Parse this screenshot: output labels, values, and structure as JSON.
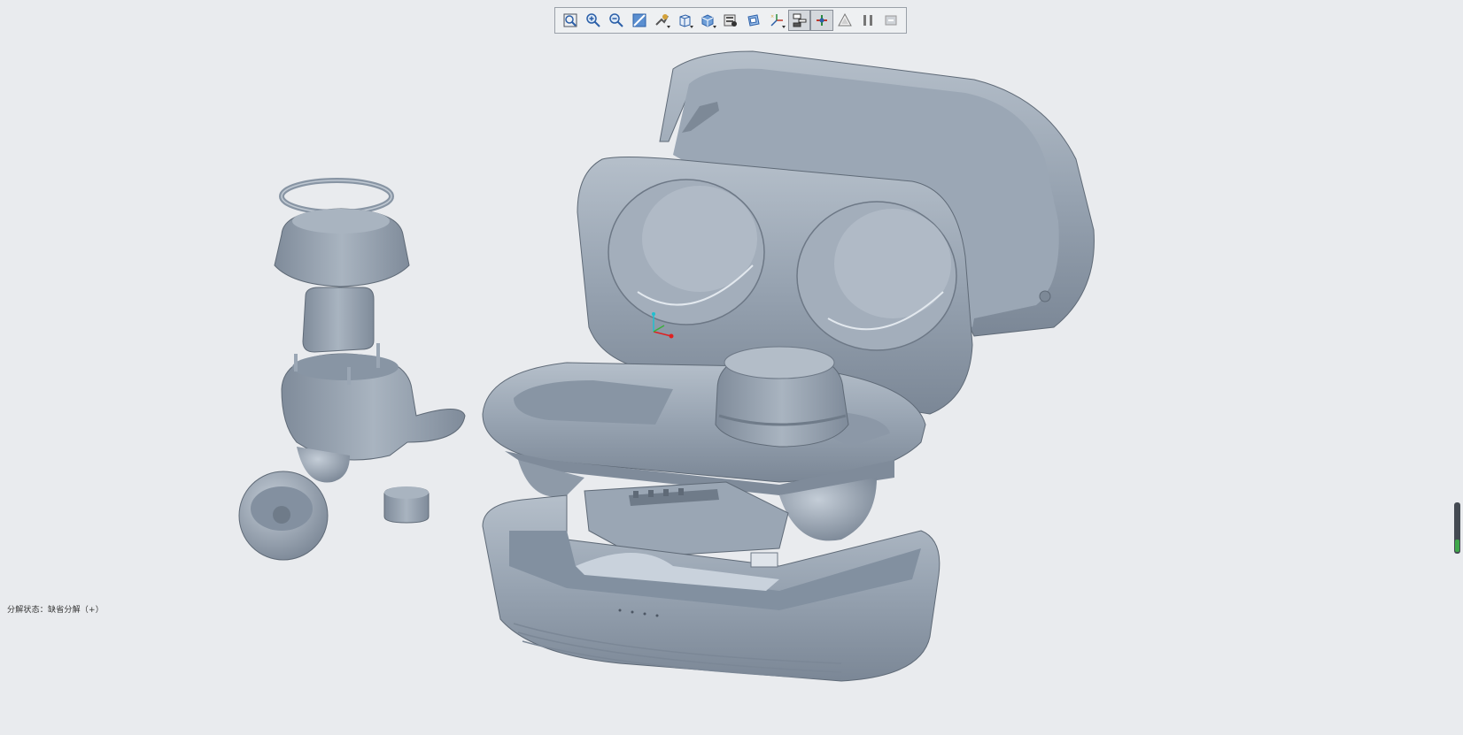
{
  "toolbar": {
    "buttons": [
      {
        "name": "refit-view-icon"
      },
      {
        "name": "zoom-in-icon"
      },
      {
        "name": "zoom-out-icon"
      },
      {
        "name": "repaint-icon"
      },
      {
        "name": "reorient-icon"
      },
      {
        "name": "saved-orientations-icon"
      },
      {
        "name": "display-style-icon"
      },
      {
        "name": "view-manager-icon"
      },
      {
        "name": "perspective-view-icon"
      },
      {
        "name": "datum-display-icon"
      },
      {
        "name": "explode-view-icon",
        "active": true
      },
      {
        "name": "edit-position-icon",
        "active": true
      },
      {
        "name": "annotation-display-icon"
      },
      {
        "name": "pause-icon"
      },
      {
        "name": "spin-center-icon"
      }
    ]
  },
  "status": {
    "explode_state": "分解状态：缺省分解（+）"
  },
  "colors": {
    "background": "#e9ebee",
    "model_surface": "#9aa6b4",
    "model_shadow": "#6f7b89",
    "model_highlight": "#c9d2dc",
    "axis_x": "#e02020",
    "axis_y": "#3ab03a",
    "axis_z": "#20c0d0",
    "scroll_indicator": "#3fa84a"
  }
}
